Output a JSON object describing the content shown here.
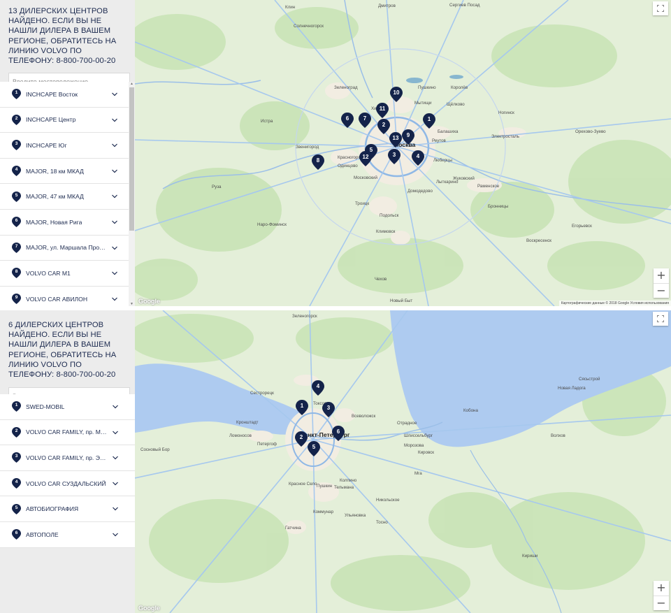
{
  "moscow": {
    "info": "13 ДИЛЕРСКИХ ЦЕНТРОВ НАЙДЕНО. ЕСЛИ ВЫ НЕ НАШЛИ ДИЛЕРА В ВАШЕМ РЕГИОНЕ, ОБРАТИТЕСЬ НА ЛИНИЮ VOLVO ПО ТЕЛЕФОНУ:",
    "phone": "8-800-700-00-20",
    "search_placeholder": "Введите местоположение",
    "dealers": [
      {
        "num": "1",
        "name": "INCHCAPE Восток"
      },
      {
        "num": "2",
        "name": "INCHCAPE Центр"
      },
      {
        "num": "3",
        "name": "INCHCAPE Юг"
      },
      {
        "num": "4",
        "name": "MAJOR, 18 км МКАД"
      },
      {
        "num": "5",
        "name": "MAJOR, 47 км МКАД"
      },
      {
        "num": "6",
        "name": "MAJOR, Новая Рига"
      },
      {
        "num": "7",
        "name": "MAJOR, ул. Маршала Прошлякова"
      },
      {
        "num": "8",
        "name": "VOLVO CAR M1"
      },
      {
        "num": "9",
        "name": "VOLVO CAR АВИЛОН"
      }
    ],
    "markers": [
      "1",
      "2",
      "3",
      "4",
      "5",
      "6",
      "7",
      "8",
      "9",
      "10",
      "11",
      "12",
      "13"
    ],
    "places": [
      "Клин",
      "Дмитров",
      "Сергиев Посад",
      "Солнечногорск",
      "Зеленоград",
      "Химки",
      "Мытищи",
      "Пушкино",
      "Щёлково",
      "Королёв",
      "Москва",
      "Балашиха",
      "Реутов",
      "Электросталь",
      "Ногинск",
      "Красногорск",
      "Одинцово",
      "Люберцы",
      "Жуковский",
      "Раменское",
      "Домодедово",
      "Подольск",
      "Климовск",
      "Чехов",
      "Наро-Фоминск",
      "Звенигород",
      "Истра",
      "Руза",
      "Орехово-Зуево",
      "Бронницы",
      "Воскресенск",
      "Егорьевск",
      "Новый Быт",
      "Троицк",
      "Московский",
      "Лыткарино"
    ],
    "attribution": "Картографические данные © 2018 Google   Условия использования",
    "google": "Google"
  },
  "spb": {
    "info": "6 ДИЛЕРСКИХ ЦЕНТРОВ НАЙДЕНО. ЕСЛИ ВЫ НЕ НАШЛИ ДИЛЕРА В ВАШЕМ РЕГИОНЕ, ОБРАТИТЕСЬ НА ЛИНИЮ VOLVO ПО ТЕЛЕФОНУ:",
    "phone": "8-800-700-00-20",
    "search_placeholder": "Введите местоположение",
    "dealers": [
      {
        "num": "1",
        "name": "SWED-MOBIL"
      },
      {
        "num": "2",
        "name": "VOLVO CAR FAMILY, пр. Маршала Жукова"
      },
      {
        "num": "3",
        "name": "VOLVO CAR FAMILY, пр. Энергетиков"
      },
      {
        "num": "4",
        "name": "VOLVO CAR СУЗДАЛЬСКИЙ"
      },
      {
        "num": "5",
        "name": "АВТОБИОГРАФИЯ"
      },
      {
        "num": "6",
        "name": "АВТОПОЛЕ"
      }
    ],
    "markers": [
      "1",
      "2",
      "3",
      "4",
      "5",
      "6"
    ],
    "places": [
      "Зеленогорск",
      "Сестрорецк",
      "Кронштадт",
      "Петергоф",
      "Ломоносов",
      "Сосновый Бор",
      "Санкт-Петербург",
      "Всеволожск",
      "Колпино",
      "Пушкин",
      "Гатчина",
      "Шлиссельбург",
      "Кировск",
      "Отрадное",
      "Красное Село",
      "Мга",
      "Тосно",
      "Коммунар",
      "Кириши",
      "Токсово",
      "Морозова",
      "Кобона",
      "Новая Ладога",
      "Сясьстрой",
      "Волхов",
      "Тельмана",
      "Ульяновка",
      "Никольское"
    ],
    "google": "Google"
  }
}
